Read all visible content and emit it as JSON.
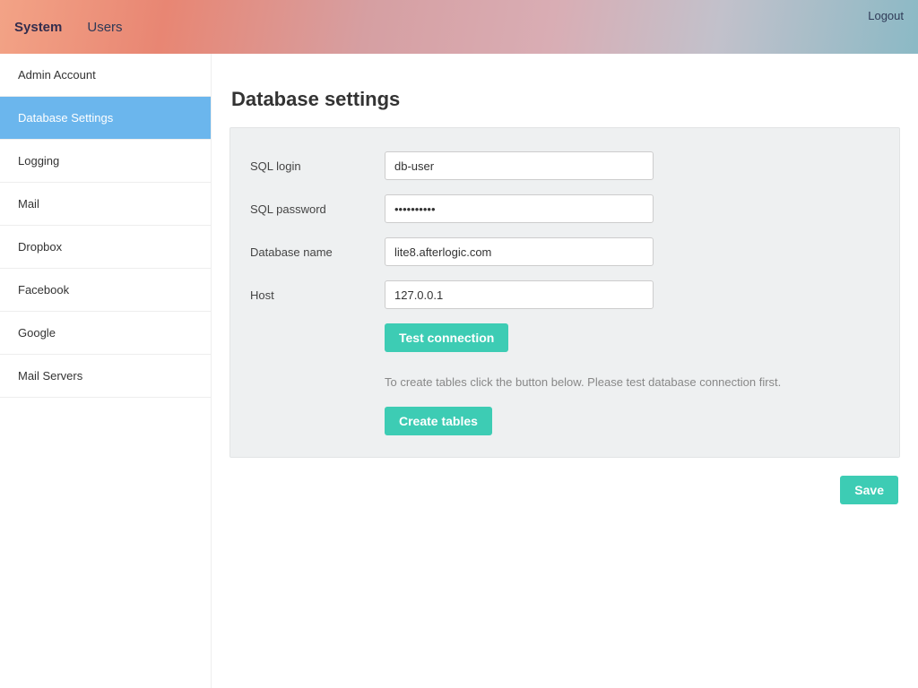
{
  "topbar": {
    "nav": [
      {
        "label": "System",
        "active": true
      },
      {
        "label": "Users",
        "active": false
      }
    ],
    "logout_label": "Logout"
  },
  "sidebar": {
    "items": [
      {
        "label": "Admin Account",
        "active": false
      },
      {
        "label": "Database Settings",
        "active": true
      },
      {
        "label": "Logging",
        "active": false
      },
      {
        "label": "Mail",
        "active": false
      },
      {
        "label": "Dropbox",
        "active": false
      },
      {
        "label": "Facebook",
        "active": false
      },
      {
        "label": "Google",
        "active": false
      },
      {
        "label": "Mail Servers",
        "active": false
      }
    ]
  },
  "main": {
    "title": "Database settings",
    "fields": {
      "sql_login_label": "SQL login",
      "sql_login_value": "db-user",
      "sql_password_label": "SQL password",
      "sql_password_value": "••••••••••",
      "db_name_label": "Database name",
      "db_name_value": "lite8.afterlogic.com",
      "host_label": "Host",
      "host_value": "127.0.0.1"
    },
    "test_connection_label": "Test connection",
    "create_hint": "To create tables click the button below. Please test database connection first.",
    "create_tables_label": "Create tables",
    "save_label": "Save"
  }
}
